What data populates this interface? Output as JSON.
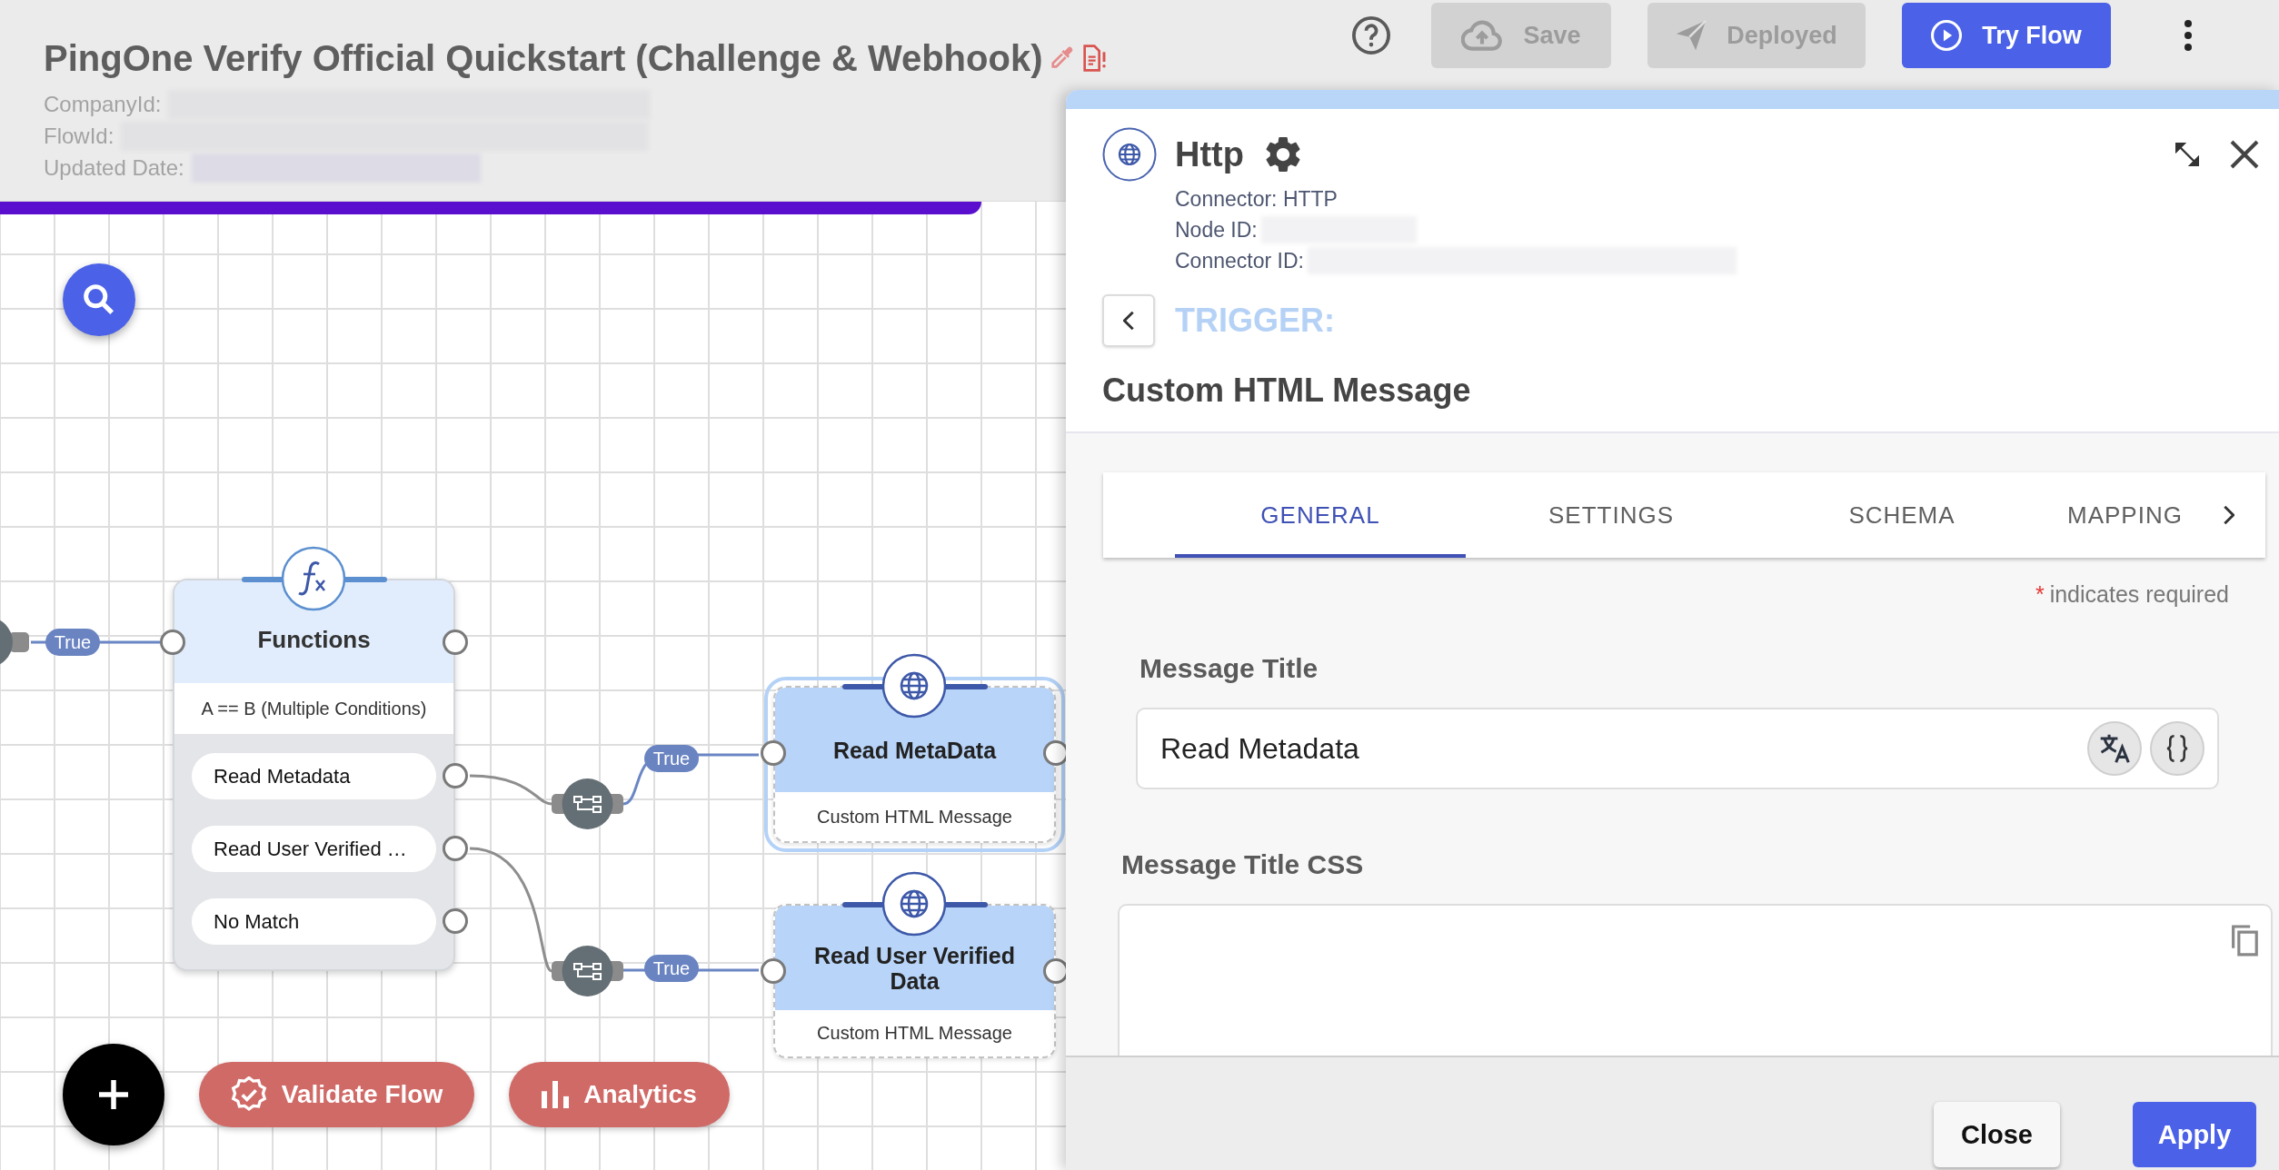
{
  "header": {
    "title": "PingOne Verify Official Quickstart (Challenge & Webhook)",
    "meta": [
      {
        "label": "CompanyId:"
      },
      {
        "label": "FlowId:"
      },
      {
        "label": "Updated Date:"
      }
    ]
  },
  "toolbar": {
    "buttons": [
      {
        "kind": "save",
        "label": "Save",
        "disabled": true
      },
      {
        "kind": "deploy",
        "label": "Deployed",
        "disabled": true
      },
      {
        "kind": "run",
        "label": "Try Flow",
        "disabled": false
      }
    ]
  },
  "canvas": {
    "edge_labels": [
      {
        "label": "True"
      },
      {
        "label": "True"
      },
      {
        "label": "True"
      }
    ],
    "function_node": {
      "title": "Functions",
      "subtitle": "A == B (Multiple Conditions)",
      "outputs": [
        {
          "label": "Read Metadata"
        },
        {
          "label": "Read User Verified …"
        },
        {
          "label": "No Match"
        }
      ]
    },
    "nodes": [
      {
        "title": "Read MetaData",
        "subtitle": "Custom HTML Message",
        "selected": true
      },
      {
        "title": "Read User Verified Data",
        "subtitle": "Custom HTML Message",
        "selected": false
      }
    ],
    "actions": [
      {
        "kind": "validate",
        "label": "Validate Flow"
      },
      {
        "kind": "analytics",
        "label": "Analytics"
      }
    ]
  },
  "panel": {
    "title": "Http",
    "details": [
      {
        "label": "Connector: HTTP"
      },
      {
        "label": "Node ID:"
      },
      {
        "label": "Connector ID:"
      }
    ],
    "trigger": {
      "label": "TRIGGER:",
      "name": "Custom HTML Message"
    },
    "tabs": [
      {
        "label": "GENERAL",
        "selected": true
      },
      {
        "label": "SETTINGS",
        "selected": false
      },
      {
        "label": "SCHEMA",
        "selected": false
      },
      {
        "label": "MAPPING",
        "selected": false
      }
    ],
    "required": {
      "mark": "*",
      "note": "indicates required"
    },
    "fields": [
      {
        "kind": "input",
        "label": "Message Title",
        "value": "Read Metadata"
      },
      {
        "kind": "code",
        "label": "Message Title CSS"
      }
    ],
    "buttons": [
      {
        "kind": "secondary",
        "label": "Close"
      },
      {
        "kind": "primary",
        "label": "Apply"
      }
    ]
  }
}
